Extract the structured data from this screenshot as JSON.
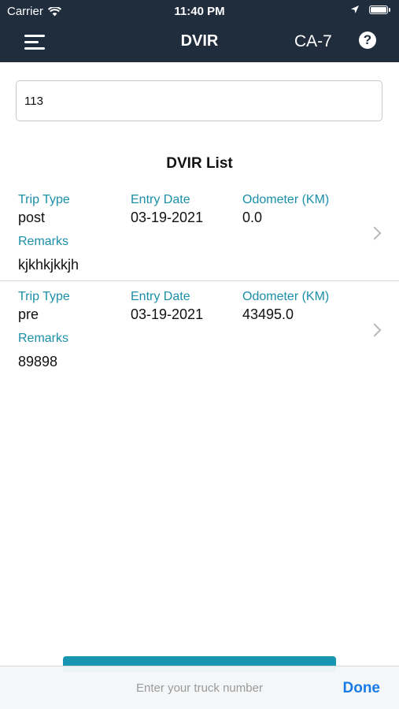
{
  "status_bar": {
    "carrier": "Carrier",
    "time": "11:40 PM"
  },
  "navbar": {
    "title": "DVIR",
    "unit": "CA-7",
    "help": "?"
  },
  "search": {
    "value": "113"
  },
  "list": {
    "title": "DVIR List",
    "labels": {
      "trip_type": "Trip Type",
      "entry_date": "Entry Date",
      "odometer": "Odometer (KM)",
      "remarks": "Remarks"
    },
    "rows": [
      {
        "trip_type": "post",
        "entry_date": "03-19-2021",
        "odometer": "0.0",
        "remarks": "kjkhkjkkjh"
      },
      {
        "trip_type": "pre",
        "entry_date": "03-19-2021",
        "odometer": "43495.0",
        "remarks": "89898"
      }
    ]
  },
  "keyboard_accessory": {
    "placeholder": "Enter your truck number",
    "done_label": "Done"
  },
  "colors": {
    "header": "#1f2d3d",
    "label": "#1b8fa8",
    "accent_button": "#1895b0",
    "done": "#1a7ae6"
  }
}
